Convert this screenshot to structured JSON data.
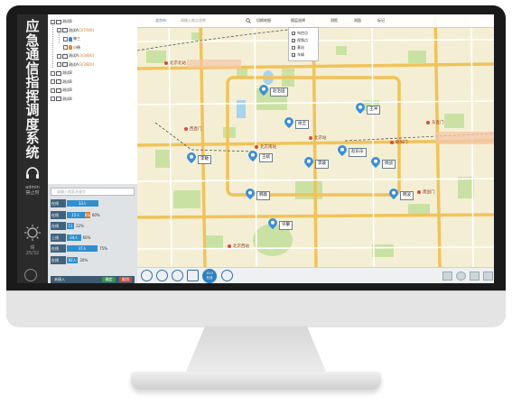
{
  "app": {
    "vertical_title": [
      "应",
      "急",
      "通",
      "信",
      "指",
      "挥",
      "调",
      "度",
      "系",
      "统"
    ],
    "user_lines": [
      "admin",
      "禁止时"
    ],
    "weather_lines": [
      "晴",
      "25/32"
    ]
  },
  "tree": [
    {
      "kind": "org",
      "label": "测试B",
      "meta": "",
      "indent": 0
    },
    {
      "kind": "org",
      "label": "测试A",
      "meta": "(3/7/9/0)",
      "indent": 1
    },
    {
      "kind": "person",
      "label": "林三",
      "meta": "",
      "indent": 2,
      "color": "#3a7bd5"
    },
    {
      "kind": "person",
      "label": "小杨",
      "meta": "",
      "indent": 2,
      "color": "#e08a1e"
    },
    {
      "kind": "org",
      "label": "测试A",
      "meta": "(3/3/8/0)",
      "indent": 1
    },
    {
      "kind": "org",
      "label": "测试A",
      "meta": "(3/3/8/0)",
      "indent": 1
    },
    {
      "kind": "org",
      "label": "测试B",
      "meta": "",
      "indent": 0
    },
    {
      "kind": "org",
      "label": "测试B",
      "meta": "",
      "indent": 0
    },
    {
      "kind": "org",
      "label": "测试B",
      "meta": "",
      "indent": 0
    },
    {
      "kind": "org",
      "label": "测试B",
      "meta": "",
      "indent": 0
    }
  ],
  "stats": {
    "search_placeholder": "请输入搜索关键字",
    "rows": [
      {
        "label": "在线",
        "bars": [
          {
            "text": "33人",
            "frac": 0.56,
            "color": "#2f8fcf"
          }
        ],
        "pct": ""
      },
      {
        "label": "在线",
        "bars": [
          {
            "text": "15人",
            "frac": 0.32,
            "color": "#2f8fcf"
          },
          {
            "text": "8%",
            "frac": 0.08,
            "color": "#e07a20"
          }
        ],
        "pct": "60%"
      },
      {
        "label": "在线",
        "bars": [
          {
            "text": "11人",
            "frac": 0.13,
            "color": "#2f8fcf"
          }
        ],
        "pct": "22%"
      },
      {
        "label": "上线",
        "bars": [
          {
            "text": "34人",
            "frac": 0.25,
            "color": "#2f8fcf"
          }
        ],
        "pct": "60%"
      },
      {
        "label": "在线",
        "bars": [
          {
            "text": "37人",
            "frac": 0.55,
            "color": "#2f8fcf"
          }
        ],
        "pct": "75%"
      },
      {
        "label": "在线",
        "bars": [
          {
            "text": "92人",
            "frac": 0.2,
            "color": "#2f8fcf"
          }
        ],
        "pct": "20%"
      }
    ],
    "footer_label": "未接入",
    "confirm_label": "确定",
    "cancel_label": "取消"
  },
  "map": {
    "toolbar": {
      "city": "北京市",
      "search_placeholder": "请输入地点名称",
      "layer_switch": "切换地图",
      "layer_menu": "图层选择",
      "tools": [
        "测距",
        "测面",
        "标记"
      ]
    },
    "layer_options": [
      {
        "label": "布控点",
        "checked": true
      },
      {
        "label": "视频点",
        "checked": true
      },
      {
        "label": "基站",
        "checked": false
      },
      {
        "label": "车辆",
        "checked": true
      }
    ],
    "markers": [
      {
        "label": "赵治国"
      },
      {
        "label": "王冲"
      },
      {
        "label": "徐全"
      },
      {
        "label": "李敏"
      },
      {
        "label": "王斌"
      },
      {
        "label": "李骏"
      },
      {
        "label": "赵乐乐"
      },
      {
        "label": "杨战"
      },
      {
        "label": "韩薇"
      },
      {
        "label": "韩波"
      },
      {
        "label": "许攀"
      }
    ],
    "pois": [
      "北京北站",
      "西直门",
      "北京南站",
      "北京站",
      "东直门",
      "朝阳门",
      "北京西站",
      "建国门"
    ]
  },
  "bottom_toolbar": {
    "counter_line1": "10/3",
    "counter_line2": "在线"
  },
  "colors": {
    "accent": "#2f8fcf",
    "panel_dark": "#41627c",
    "confirm": "#2e9a47",
    "cancel": "#d0483a"
  }
}
